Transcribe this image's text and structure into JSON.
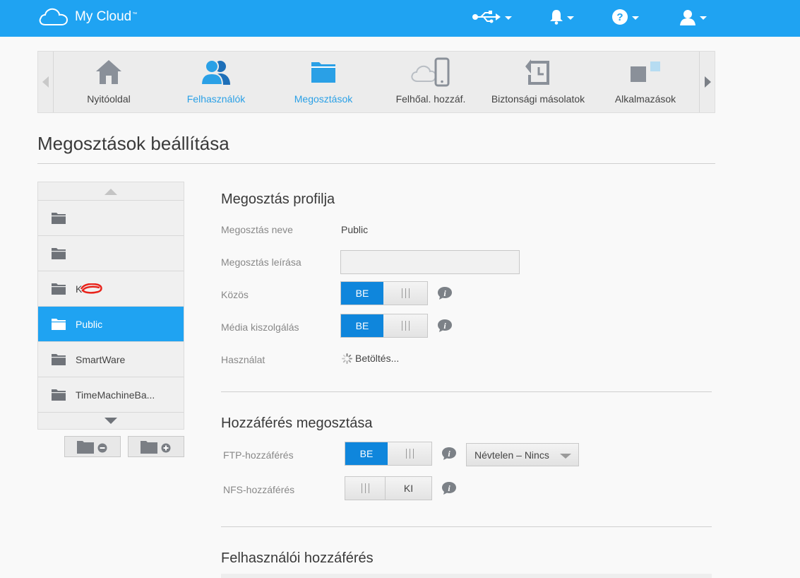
{
  "header": {
    "app_name": "My Cloud",
    "trademark": "™",
    "icons": [
      "usb-icon",
      "bell-icon",
      "help-icon",
      "user-icon"
    ]
  },
  "nav": {
    "items": [
      {
        "label": "Nyitóoldal",
        "icon": "home-icon",
        "active": false
      },
      {
        "label": "Felhasználók",
        "icon": "users-icon",
        "active": true
      },
      {
        "label": "Megosztások",
        "icon": "folder-icon",
        "active": true
      },
      {
        "label": "Felhőal. hozzáf.",
        "icon": "cloud-device-icon",
        "active": false
      },
      {
        "label": "Biztonsági másolatok",
        "icon": "backup-icon",
        "active": false
      },
      {
        "label": "Alkalmazások",
        "icon": "apps-icon",
        "active": false
      }
    ]
  },
  "page": {
    "title": "Megosztások beállítása"
  },
  "sharelist": {
    "items": [
      {
        "name": "",
        "redacted": true,
        "selected": false
      },
      {
        "name": "",
        "redacted": true,
        "selected": false
      },
      {
        "name": "K",
        "redacted": true,
        "selected": false
      },
      {
        "name": "Public",
        "redacted": false,
        "selected": true
      },
      {
        "name": "SmartWare",
        "redacted": false,
        "selected": false
      },
      {
        "name": "TimeMachineBa...",
        "redacted": false,
        "selected": false
      }
    ]
  },
  "profile": {
    "title": "Megosztás profilja",
    "name_label": "Megosztás neve",
    "name_value": "Public",
    "desc_label": "Megosztás leírása",
    "desc_value": "",
    "public_label": "Közös",
    "public_state": "BE",
    "media_label": "Média kiszolgálás",
    "media_state": "BE",
    "usage_label": "Használat",
    "usage_value": "Betöltés..."
  },
  "access": {
    "title": "Hozzáférés megosztása",
    "ftp_label": "FTP-hozzáférés",
    "ftp_state": "BE",
    "ftp_option": "Névtelen – Nincs",
    "nfs_label": "NFS-hozzáférés",
    "nfs_state": "KI"
  },
  "user_access": {
    "title": "Felhasználói hozzáférés"
  },
  "colors": {
    "topbar": "#1fa3f2",
    "accent": "#2aa0e6",
    "toggle_on": "#0f86dc"
  }
}
